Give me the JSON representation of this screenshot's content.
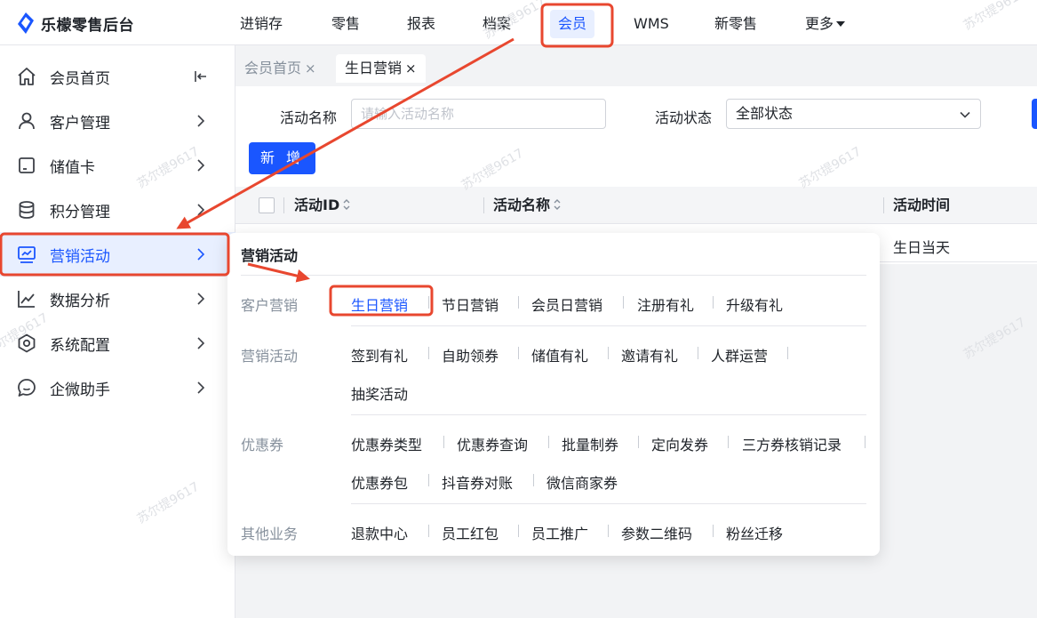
{
  "app": {
    "title": "乐檬零售后台"
  },
  "topnav": {
    "items": [
      {
        "label": "进销存"
      },
      {
        "label": "零售"
      },
      {
        "label": "报表"
      },
      {
        "label": "档案"
      },
      {
        "label": "会员",
        "active": true
      },
      {
        "label": "WMS"
      },
      {
        "label": "新零售"
      },
      {
        "label": "更多"
      }
    ]
  },
  "sidebar": {
    "items": [
      {
        "label": "会员首页",
        "icon": "home-icon"
      },
      {
        "label": "客户管理",
        "icon": "user-icon"
      },
      {
        "label": "储值卡",
        "icon": "card-icon"
      },
      {
        "label": "积分管理",
        "icon": "database-icon"
      },
      {
        "label": "营销活动",
        "icon": "monitor-chart-icon",
        "active": true
      },
      {
        "label": "数据分析",
        "icon": "line-chart-icon"
      },
      {
        "label": "系统配置",
        "icon": "settings-icon"
      },
      {
        "label": "企微助手",
        "icon": "chat-icon"
      }
    ]
  },
  "tabs": [
    {
      "label": "会员首页",
      "close": "×"
    },
    {
      "label": "生日营销",
      "close": "×",
      "active": true
    }
  ],
  "filters": {
    "name_label": "活动名称",
    "name_placeholder": "请输入活动名称",
    "status_label": "活动状态",
    "status_value": "全部状态"
  },
  "add_button": "新 增",
  "table": {
    "columns": [
      "活动ID",
      "活动名称",
      "活动时间"
    ],
    "rows": [
      {
        "time": "生日当天"
      }
    ]
  },
  "menu": {
    "title": "营销活动",
    "groups": [
      {
        "name": "客户营销",
        "rows": [
          [
            "生日营销",
            "节日营销",
            "会员日营销",
            "注册有礼",
            "升级有礼"
          ]
        ]
      },
      {
        "name": "营销活动",
        "rows": [
          [
            "签到有礼",
            "自助领券",
            "储值有礼",
            "邀请有礼",
            "人群运营"
          ],
          [
            "抽奖活动"
          ]
        ]
      },
      {
        "name": "优惠券",
        "rows": [
          [
            "优惠券类型",
            "优惠券查询",
            "批量制券",
            "定向发券",
            "三方券核销记录"
          ],
          [
            "优惠券包",
            "抖音券对账",
            "微信商家券"
          ]
        ]
      },
      {
        "name": "其他业务",
        "rows": [
          [
            "退款中心",
            "员工红包",
            "员工推广",
            "参数二维码",
            "粉丝迁移"
          ]
        ]
      }
    ]
  },
  "watermark": "苏尔提9617",
  "colors": {
    "accent": "#1a56ff",
    "annotation": "#e8472f"
  }
}
